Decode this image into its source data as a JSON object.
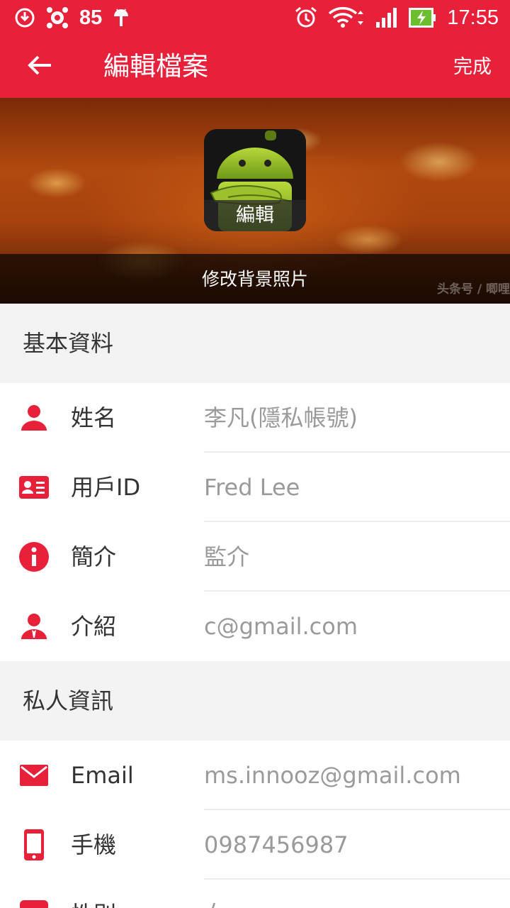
{
  "status_bar": {
    "battery_saver_value": "85",
    "time": "17:55"
  },
  "app_bar": {
    "title": "編輯檔案",
    "done_label": "完成"
  },
  "cover": {
    "avatar_edit_label": "編輯",
    "change_background_label": "修改背景照片",
    "watermark": "头条号 / 唧哩"
  },
  "sections": {
    "basic": {
      "title": "基本資料",
      "rows": [
        {
          "icon": "person-icon",
          "label": "姓名",
          "value": "李凡(隱私帳號)"
        },
        {
          "icon": "id-card-icon",
          "label": "用戶ID",
          "value": "Fred Lee"
        },
        {
          "icon": "info-icon",
          "label": "簡介",
          "value": "監介"
        },
        {
          "icon": "person-tie-icon",
          "label": "介紹",
          "value": "c@gmail.com"
        }
      ]
    },
    "private": {
      "title": "私人資訊",
      "rows": [
        {
          "icon": "mail-icon",
          "label": "Email",
          "value": "ms.innooz@gmail.com"
        },
        {
          "icon": "phone-icon",
          "label": "手機",
          "value": "0987456987"
        },
        {
          "icon": "gender-icon",
          "label": "性別",
          "value": "女"
        }
      ]
    }
  },
  "colors": {
    "accent": "#e8213b",
    "section_bg": "#f3f3f3",
    "value_text": "#9a9a9a"
  }
}
